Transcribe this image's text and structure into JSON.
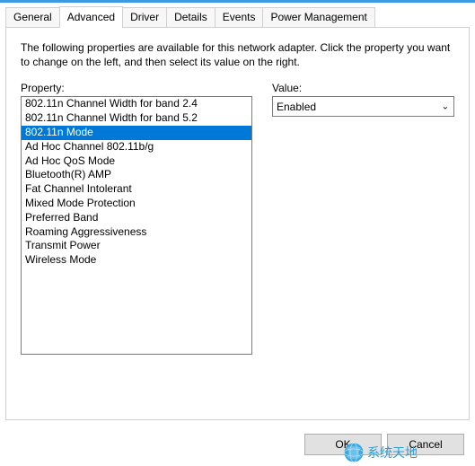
{
  "tabs": {
    "general": "General",
    "advanced": "Advanced",
    "driver": "Driver",
    "details": "Details",
    "events": "Events",
    "power": "Power Management",
    "activeIndex": 1
  },
  "intro": "The following properties are available for this network adapter. Click the property you want to change on the left, and then select its value on the right.",
  "labels": {
    "property": "Property:",
    "value": "Value:"
  },
  "properties": [
    "802.11n Channel Width for band 2.4",
    "802.11n Channel Width for band 5.2",
    "802.11n Mode",
    "Ad Hoc Channel 802.11b/g",
    "Ad Hoc QoS Mode",
    "Bluetooth(R) AMP",
    "Fat Channel Intolerant",
    "Mixed Mode Protection",
    "Preferred Band",
    "Roaming Aggressiveness",
    "Transmit Power",
    "Wireless Mode"
  ],
  "selectedPropertyIndex": 2,
  "value": {
    "selected": "Enabled"
  },
  "buttons": {
    "ok": "OK",
    "cancel": "Cancel"
  },
  "watermark": "系统天地"
}
